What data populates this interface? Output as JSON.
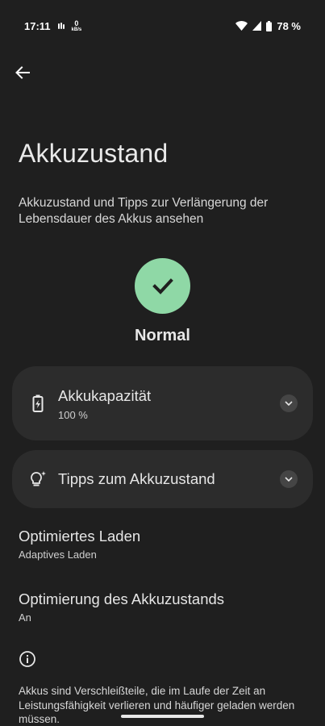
{
  "status_bar": {
    "time": "17:11",
    "net_speed_value": "0",
    "net_speed_unit": "kB/s",
    "battery_percent": "78 %"
  },
  "header": {
    "title": "Akkuzustand",
    "subtitle": "Akkuzustand und Tipps zur Verlängerung der Lebensdauer des Akkus ansehen"
  },
  "health": {
    "status": "Normal",
    "accent": "#8fd8a6"
  },
  "cards": {
    "capacity": {
      "title": "Akkukapazität",
      "value": "100 %"
    },
    "tips": {
      "title": "Tipps zum Akkuzustand"
    }
  },
  "settings": {
    "optimized_charging": {
      "title": "Optimiertes Laden",
      "value": "Adaptives Laden"
    },
    "health_optimization": {
      "title": "Optimierung des Akkuzustands",
      "value": "An"
    }
  },
  "footer": {
    "info": "Akkus sind Verschleißteile, die im Laufe der Zeit an Leistungsfähigkeit verlieren und häufiger geladen werden müssen."
  }
}
